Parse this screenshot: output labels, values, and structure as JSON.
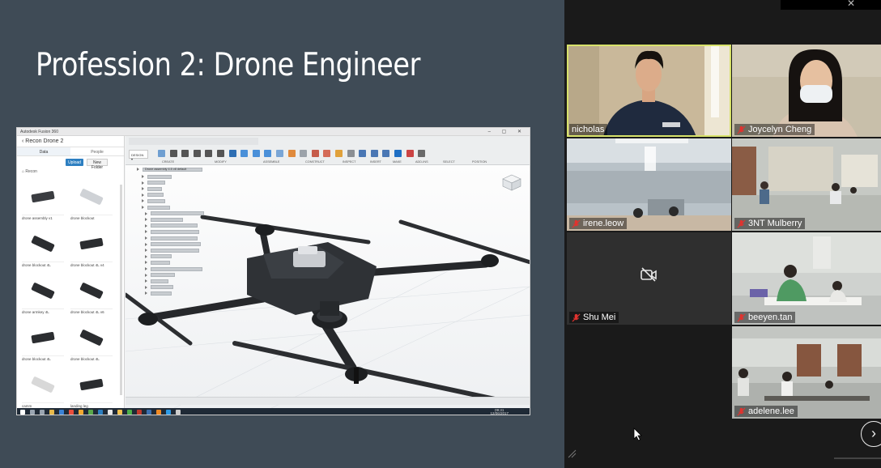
{
  "slide": {
    "title": "Profession 2: Drone Engineer",
    "background": "#3f4b56"
  },
  "fusion": {
    "window_title": "Autodesk Fusion 360",
    "data_panel": {
      "project": "Recon Drone 2",
      "tabs": [
        "Data",
        "People"
      ],
      "upload_label": "Upload",
      "new_folder_label": "New Folder",
      "crumb": "Recon",
      "items": [
        {
          "caption": "drone assembly v1"
        },
        {
          "caption": "drone blockout"
        },
        {
          "caption": "drone blockout 4L"
        },
        {
          "caption": "drone blockout 4L v4"
        },
        {
          "caption": "drone armkey 4L"
        },
        {
          "caption": "drone blockout 4L v6"
        },
        {
          "caption": "drone blockout 4L"
        },
        {
          "caption": "drone blockout 4L"
        },
        {
          "caption": "camm"
        },
        {
          "caption": "landing leg"
        }
      ]
    },
    "toolbar_groups": [
      "CREATE",
      "MODIFY",
      "ASSEMBLE",
      "CONSTRUCT",
      "INSPECT",
      "INSERT",
      "MAKE",
      "ADD-INS",
      "SELECT",
      "POSITION"
    ],
    "browser_root": "Drone assembly 4.5 v8 default",
    "taskbar_clock": {
      "time": "09:41",
      "date": "12/06/2017"
    },
    "icons": [
      "cursor-icon",
      "viewcube-icon",
      "windows-start-icon"
    ]
  },
  "gallery": {
    "participants": [
      {
        "name": "nicholas",
        "muted": false,
        "active_speaker": true,
        "video": true
      },
      {
        "name": "Joycelyn Cheng",
        "muted": true,
        "active_speaker": false,
        "video": true
      },
      {
        "name": "irene.leow",
        "muted": true,
        "active_speaker": false,
        "video": true
      },
      {
        "name": "3NT Mulberry",
        "muted": true,
        "active_speaker": false,
        "video": true
      },
      {
        "name": "Shu Mei",
        "muted": true,
        "active_speaker": false,
        "video": false
      },
      {
        "name": "beeyen.tan",
        "muted": true,
        "active_speaker": false,
        "video": true
      },
      {
        "name": "adelene.lee",
        "muted": true,
        "active_speaker": false,
        "video": true
      }
    ],
    "next_page_icon": "chevron-right-icon",
    "active_speaker_color": "#d7e26a",
    "muted_icon_color": "#e0332f"
  }
}
